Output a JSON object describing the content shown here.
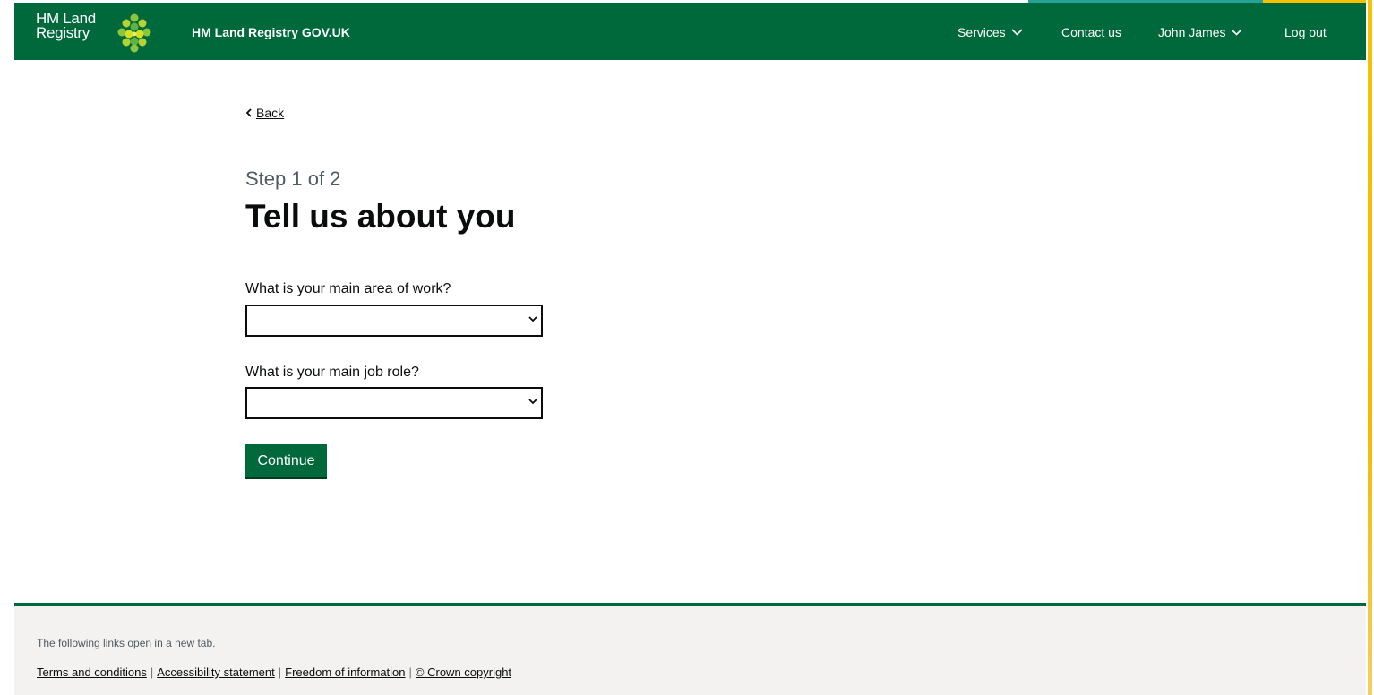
{
  "header": {
    "logo_line1": "HM Land",
    "logo_line2": "Registry",
    "service_name": "HM Land Registry GOV.UK",
    "nav": {
      "services": "Services",
      "contact": "Contact us",
      "user": "John James",
      "logout": "Log out"
    }
  },
  "main": {
    "back_label": "Back",
    "step_caption": "Step 1 of 2",
    "title": "Tell us about you",
    "fields": [
      {
        "label": "What is your main area of work?",
        "value": ""
      },
      {
        "label": "What is your main job role?",
        "value": ""
      }
    ],
    "continue_label": "Continue"
  },
  "footer": {
    "note": "The following links open in a new tab.",
    "links": [
      "Terms and conditions",
      "Accessibility statement",
      "Freedom of information",
      "© Crown copyright"
    ]
  },
  "colors": {
    "brand_green": "#00693b",
    "footer_bg": "#f3f2f1",
    "accent_yellow": "#f6c200",
    "accent_teal": "#28a197"
  },
  "icons": {
    "logo": "hm-land-registry-crest-icon",
    "services_dropdown": "chevron-down-icon",
    "user_dropdown": "chevron-down-icon",
    "back": "chevron-left-icon",
    "select": "chevron-down-icon"
  }
}
